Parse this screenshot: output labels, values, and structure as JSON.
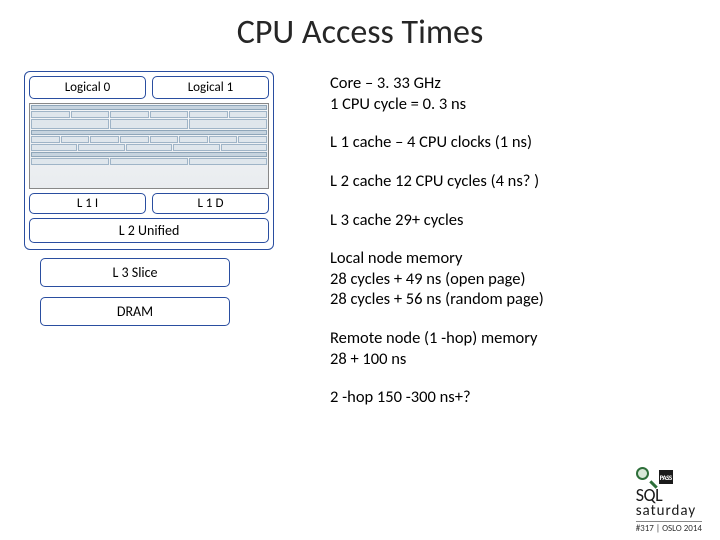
{
  "title": "CPU Access Times",
  "diagram": {
    "logical0": "Logical 0",
    "logical1": "Logical 1",
    "l1i": "L 1 I",
    "l1d": "L 1 D",
    "l2unified": "L 2 Unified",
    "l3slice": "L 3 Slice",
    "dram": "DRAM"
  },
  "facts": {
    "core_line1": "Core – 3. 33 GHz",
    "core_line2": "1 CPU cycle = 0. 3 ns",
    "l1": "L 1 cache – 4 CPU clocks (1 ns)",
    "l2": "L 2 cache 12 CPU cycles (4 ns? )",
    "l3": "L 3 cache 29+ cycles",
    "local_line1": "Local node memory",
    "local_line2": "28 cycles + 49 ns (open page)",
    "local_line3": "28 cycles + 56 ns (random page)",
    "remote_line1": "Remote node (1 -hop) memory",
    "remote_line2": "28 + 100 ns",
    "twohop": "2 -hop 150 -300 ns+?"
  },
  "footer": {
    "pass": "PASS",
    "sql": "SQL",
    "saturday": "saturday",
    "event": "#317 | OSLO 2014"
  }
}
